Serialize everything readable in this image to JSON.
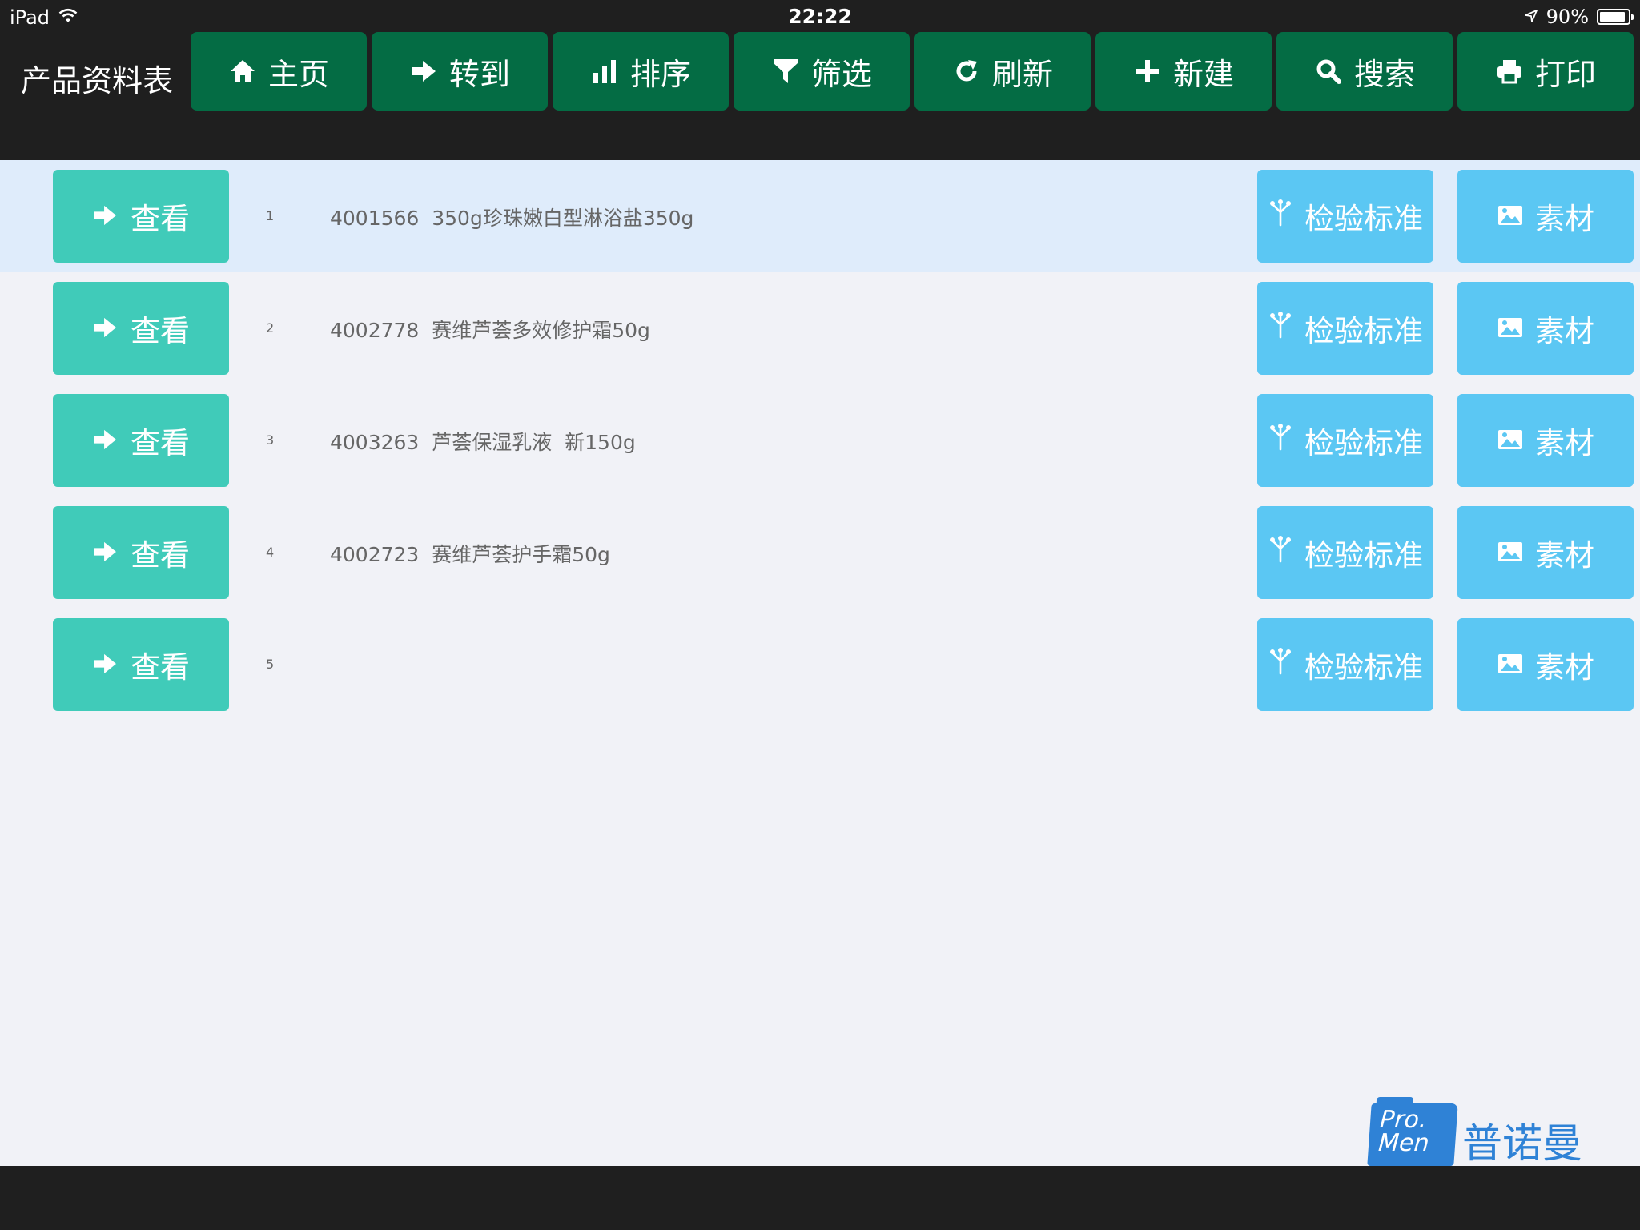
{
  "status_bar": {
    "carrier": "iPad",
    "time": "22:22",
    "battery": "90%",
    "battery_level": 0.9
  },
  "app_title": "产品资料表",
  "toolbar": [
    {
      "label": "主页",
      "icon": "home-icon"
    },
    {
      "label": "转到",
      "icon": "arrow-right-icon"
    },
    {
      "label": "排序",
      "icon": "bar-chart-icon"
    },
    {
      "label": "筛选",
      "icon": "filter-icon"
    },
    {
      "label": "刷新",
      "icon": "refresh-icon"
    },
    {
      "label": "新建",
      "icon": "plus-icon"
    },
    {
      "label": "搜索",
      "icon": "search-icon"
    },
    {
      "label": "打印",
      "icon": "print-icon"
    }
  ],
  "list": {
    "view_label": "查看",
    "standard_label": "检验标准",
    "material_label": "素材",
    "rows": [
      {
        "num": "1",
        "text": "4001566  350g珍珠嫩白型淋浴盐350g",
        "selected": true
      },
      {
        "num": "2",
        "text": "4002778  赛维芦荟多效修护霜50g",
        "selected": false
      },
      {
        "num": "3",
        "text": "4003263  芦荟保湿乳液  新150g",
        "selected": false
      },
      {
        "num": "4",
        "text": "4002723  赛维芦荟护手霜50g",
        "selected": false
      },
      {
        "num": "5",
        "text": "",
        "selected": false
      }
    ]
  },
  "logo": {
    "mark_line1": "Pro.",
    "mark_line2": "Men",
    "text": "普诺曼"
  },
  "colors": {
    "toolbar_button": "#046c44",
    "view_button": "#40cbb9",
    "action_button": "#5bc7f3",
    "selected_row": "#dfecfb",
    "background": "#f1f2f7",
    "bar": "#1f1f1f"
  }
}
